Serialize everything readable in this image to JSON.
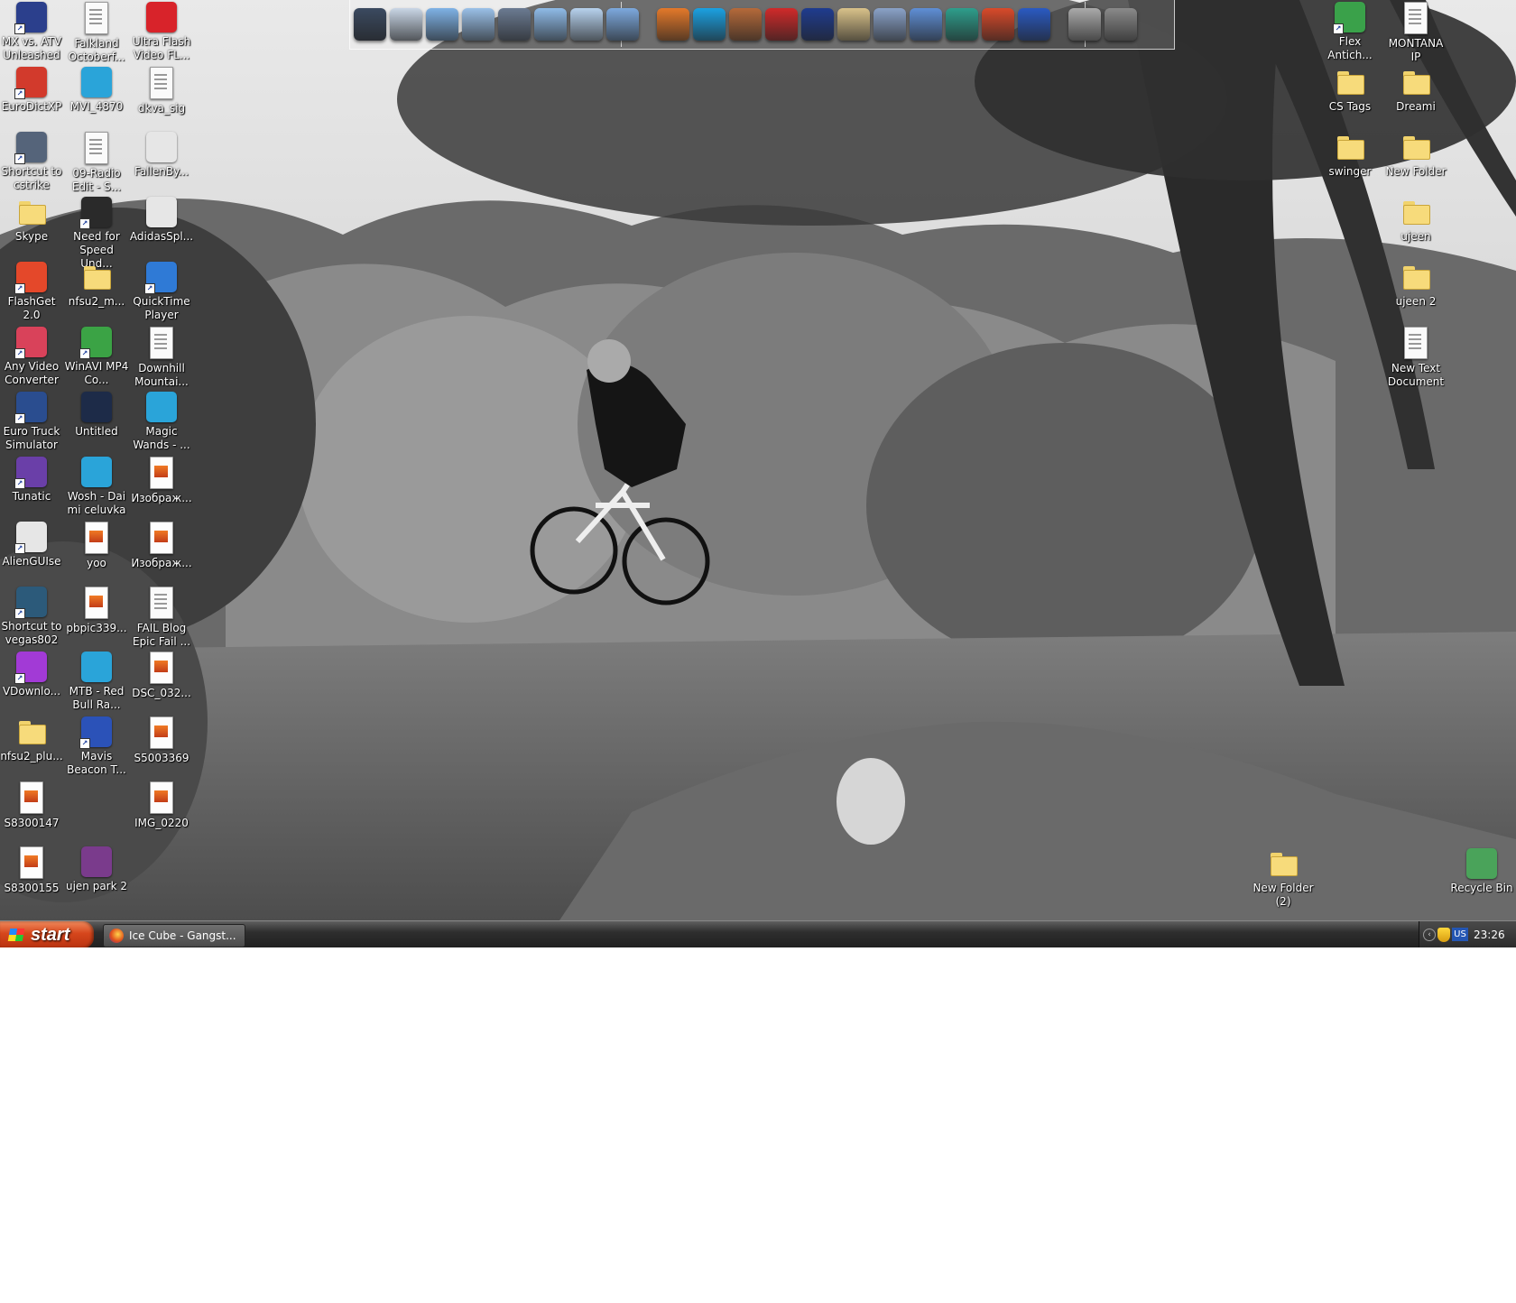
{
  "desktop": {
    "icons_left": [
      {
        "label": "MX vs. ATV Unleashed",
        "type": "app",
        "color": "#2b3f8c",
        "shortcut": true,
        "col": 0,
        "row": 0
      },
      {
        "label": "Falkland Octoberf...",
        "type": "doc",
        "color": "#eeeeee",
        "shortcut": false,
        "col": 1,
        "row": 0
      },
      {
        "label": "Ultra Flash Video FL...",
        "type": "app",
        "color": "#d8232a",
        "shortcut": false,
        "col": 2,
        "row": 0
      },
      {
        "label": "EuroDictXP",
        "type": "app",
        "color": "#d23a2c",
        "shortcut": true,
        "col": 0,
        "row": 1
      },
      {
        "label": "MVI_4870",
        "type": "app",
        "color": "#2aa4d9",
        "shortcut": false,
        "col": 1,
        "row": 1
      },
      {
        "label": "dkva_sig",
        "type": "doc",
        "color": "#eeeeee",
        "shortcut": false,
        "col": 2,
        "row": 1
      },
      {
        "label": "Shortcut to cstrike",
        "type": "app",
        "color": "#55647a",
        "shortcut": true,
        "col": 0,
        "row": 2
      },
      {
        "label": "09-Radio Edit - S...",
        "type": "doc",
        "color": "#eeeeee",
        "shortcut": false,
        "col": 1,
        "row": 2
      },
      {
        "label": "FallenBy...",
        "type": "app",
        "color": "#e6e6e6",
        "shortcut": false,
        "col": 2,
        "row": 2
      },
      {
        "label": "Skype",
        "type": "folder",
        "color": "#f7db7b",
        "shortcut": false,
        "col": 0,
        "row": 3
      },
      {
        "label": "Need for Speed Und...",
        "type": "app",
        "color": "#2a2a2a",
        "shortcut": true,
        "col": 1,
        "row": 3
      },
      {
        "label": "AdidasSpl...",
        "type": "app",
        "color": "#e6e6e6",
        "shortcut": false,
        "col": 2,
        "row": 3
      },
      {
        "label": "FlashGet 2.0",
        "type": "app",
        "color": "#e4482a",
        "shortcut": true,
        "col": 0,
        "row": 4
      },
      {
        "label": "nfsu2_m...",
        "type": "folder",
        "color": "#f7db7b",
        "shortcut": false,
        "col": 1,
        "row": 4
      },
      {
        "label": "QuickTime Player",
        "type": "app",
        "color": "#2f7ad6",
        "shortcut": true,
        "col": 2,
        "row": 4
      },
      {
        "label": "Any Video Converter",
        "type": "app",
        "color": "#d9425a",
        "shortcut": true,
        "col": 0,
        "row": 5
      },
      {
        "label": "WinAVI MP4 Co...",
        "type": "app",
        "color": "#3ba345",
        "shortcut": true,
        "col": 1,
        "row": 5
      },
      {
        "label": "Downhill Mountai...",
        "type": "doc",
        "color": "#eeeeee",
        "shortcut": false,
        "col": 2,
        "row": 5
      },
      {
        "label": "Euro Truck Simulator",
        "type": "app",
        "color": "#2a4d8f",
        "shortcut": true,
        "col": 0,
        "row": 6
      },
      {
        "label": "Untitled",
        "type": "app",
        "color": "#1d2b48",
        "shortcut": false,
        "col": 1,
        "row": 6
      },
      {
        "label": "Magic Wands - ...",
        "type": "app",
        "color": "#2aa4d9",
        "shortcut": false,
        "col": 2,
        "row": 6
      },
      {
        "label": "Tunatic",
        "type": "app",
        "color": "#6a3fa8",
        "shortcut": true,
        "col": 0,
        "row": 7
      },
      {
        "label": "Wosh - Dai mi celuvka",
        "type": "app",
        "color": "#2aa4d9",
        "shortcut": false,
        "col": 1,
        "row": 7
      },
      {
        "label": "Изображ...",
        "type": "img",
        "color": "#e06a20",
        "shortcut": false,
        "col": 2,
        "row": 7
      },
      {
        "label": "AlienGUIse",
        "type": "app",
        "color": "#e6e6e6",
        "shortcut": true,
        "col": 0,
        "row": 8
      },
      {
        "label": "yoo",
        "type": "img",
        "color": "#e06a20",
        "shortcut": false,
        "col": 1,
        "row": 8
      },
      {
        "label": "Изображ...",
        "type": "img",
        "color": "#e06a20",
        "shortcut": false,
        "col": 2,
        "row": 8
      },
      {
        "label": "Shortcut to vegas802",
        "type": "app",
        "color": "#2c5a7a",
        "shortcut": true,
        "col": 0,
        "row": 9
      },
      {
        "label": "pbpic339...",
        "type": "img",
        "color": "#e06a20",
        "shortcut": false,
        "col": 1,
        "row": 9
      },
      {
        "label": "FAIL Blog Epic Fail ...",
        "type": "doc",
        "color": "#eeeeee",
        "shortcut": false,
        "col": 2,
        "row": 9
      },
      {
        "label": "VDownlo...",
        "type": "app",
        "color": "#a23ad6",
        "shortcut": true,
        "col": 0,
        "row": 10
      },
      {
        "label": "MTB - Red Bull Ra...",
        "type": "app",
        "color": "#2aa4d9",
        "shortcut": false,
        "col": 1,
        "row": 10
      },
      {
        "label": "DSC_032...",
        "type": "img",
        "color": "#e06a20",
        "shortcut": false,
        "col": 2,
        "row": 10
      },
      {
        "label": "nfsu2_plu...",
        "type": "folder",
        "color": "#f7db7b",
        "shortcut": false,
        "col": 0,
        "row": 11
      },
      {
        "label": "Mavis Beacon T...",
        "type": "app",
        "color": "#2b52b8",
        "shortcut": true,
        "col": 1,
        "row": 11
      },
      {
        "label": "S5003369",
        "type": "img",
        "color": "#e06a20",
        "shortcut": false,
        "col": 2,
        "row": 11
      },
      {
        "label": "S8300147",
        "type": "img",
        "color": "#e06a20",
        "shortcut": false,
        "col": 0,
        "row": 12
      },
      {
        "label": "IMG_0220",
        "type": "img",
        "color": "#e06a20",
        "shortcut": false,
        "col": 2,
        "row": 12
      },
      {
        "label": "S8300155",
        "type": "img",
        "color": "#e06a20",
        "shortcut": false,
        "col": 0,
        "row": 13
      },
      {
        "label": "ujen park 2",
        "type": "app",
        "color": "#7a3b8c",
        "shortcut": false,
        "col": 1,
        "row": 13
      }
    ],
    "icons_right": [
      {
        "label": "Flex Antich...",
        "type": "app",
        "color": "#3aa14a",
        "shortcut": true,
        "col": 0,
        "row": 0
      },
      {
        "label": "MONTANA IP",
        "type": "doc",
        "color": "#eeeeee",
        "shortcut": false,
        "col": 1,
        "row": 0
      },
      {
        "label": "CS Tags",
        "type": "folder",
        "color": "#f7db7b",
        "shortcut": false,
        "col": 0,
        "row": 1
      },
      {
        "label": "Dreami",
        "type": "folder",
        "color": "#f7db7b",
        "shortcut": false,
        "col": 1,
        "row": 1
      },
      {
        "label": "swinger",
        "type": "folder",
        "color": "#f7db7b",
        "shortcut": false,
        "col": 0,
        "row": 2
      },
      {
        "label": "New Folder",
        "type": "folder",
        "color": "#f7db7b",
        "shortcut": false,
        "col": 1,
        "row": 2
      },
      {
        "label": "ujeen",
        "type": "folder",
        "color": "#f7db7b",
        "shortcut": false,
        "col": 1,
        "row": 3
      },
      {
        "label": "ujeen 2",
        "type": "folder",
        "color": "#f7db7b",
        "shortcut": false,
        "col": 1,
        "row": 4
      },
      {
        "label": "New Text Document",
        "type": "doc",
        "color": "#eeeeee",
        "shortcut": false,
        "col": 1,
        "row": 5
      }
    ],
    "icons_bottom_right": [
      {
        "label": "New Folder (2)",
        "type": "folder",
        "color": "#f7db7b"
      },
      {
        "label": "Recycle Bin",
        "type": "app",
        "color": "#4aa35a"
      }
    ]
  },
  "dock": {
    "items": [
      {
        "icon": "monitor-icon",
        "color": "#3b4a60"
      },
      {
        "icon": "window-icon",
        "color": "#c9d6e6"
      },
      {
        "icon": "music-folder-icon",
        "color": "#7fb2e6"
      },
      {
        "icon": "pictures-folder-icon",
        "color": "#9ac0e8"
      },
      {
        "icon": "video-folder-icon",
        "color": "#6b7b92"
      },
      {
        "icon": "desktop-folder-icon",
        "color": "#8fbbe8"
      },
      {
        "icon": "network-icon",
        "color": "#b7d2ee"
      },
      {
        "icon": "documents-folder-icon",
        "color": "#7da9de"
      },
      {
        "icon": "firefox-icon",
        "color": "#e4792a"
      },
      {
        "icon": "skype-icon",
        "color": "#1ba1e2"
      },
      {
        "icon": "avatar-icon",
        "color": "#b56a3a"
      },
      {
        "icon": "calendar-icon",
        "color": "#d02a2a"
      },
      {
        "icon": "uk-flag-icon",
        "color": "#1f3c8f"
      },
      {
        "icon": "paint-palette-icon",
        "color": "#d9c28a"
      },
      {
        "icon": "calculator-icon",
        "color": "#8aa2c8"
      },
      {
        "icon": "itunes-icon",
        "color": "#5f8fd6"
      },
      {
        "icon": "dolphin-icon",
        "color": "#2e9e8c"
      },
      {
        "icon": "pencil-icon",
        "color": "#d94a2a"
      },
      {
        "icon": "globe-icon",
        "color": "#2a5ac2"
      },
      {
        "icon": "tools-icon",
        "color": "#aaaaaa"
      },
      {
        "icon": "trash-icon",
        "color": "#8a8a8a"
      }
    ]
  },
  "taskbar": {
    "start_label": "start",
    "task_label": "Ice Cube - Gangst...",
    "language": "US",
    "clock": "23:26"
  }
}
